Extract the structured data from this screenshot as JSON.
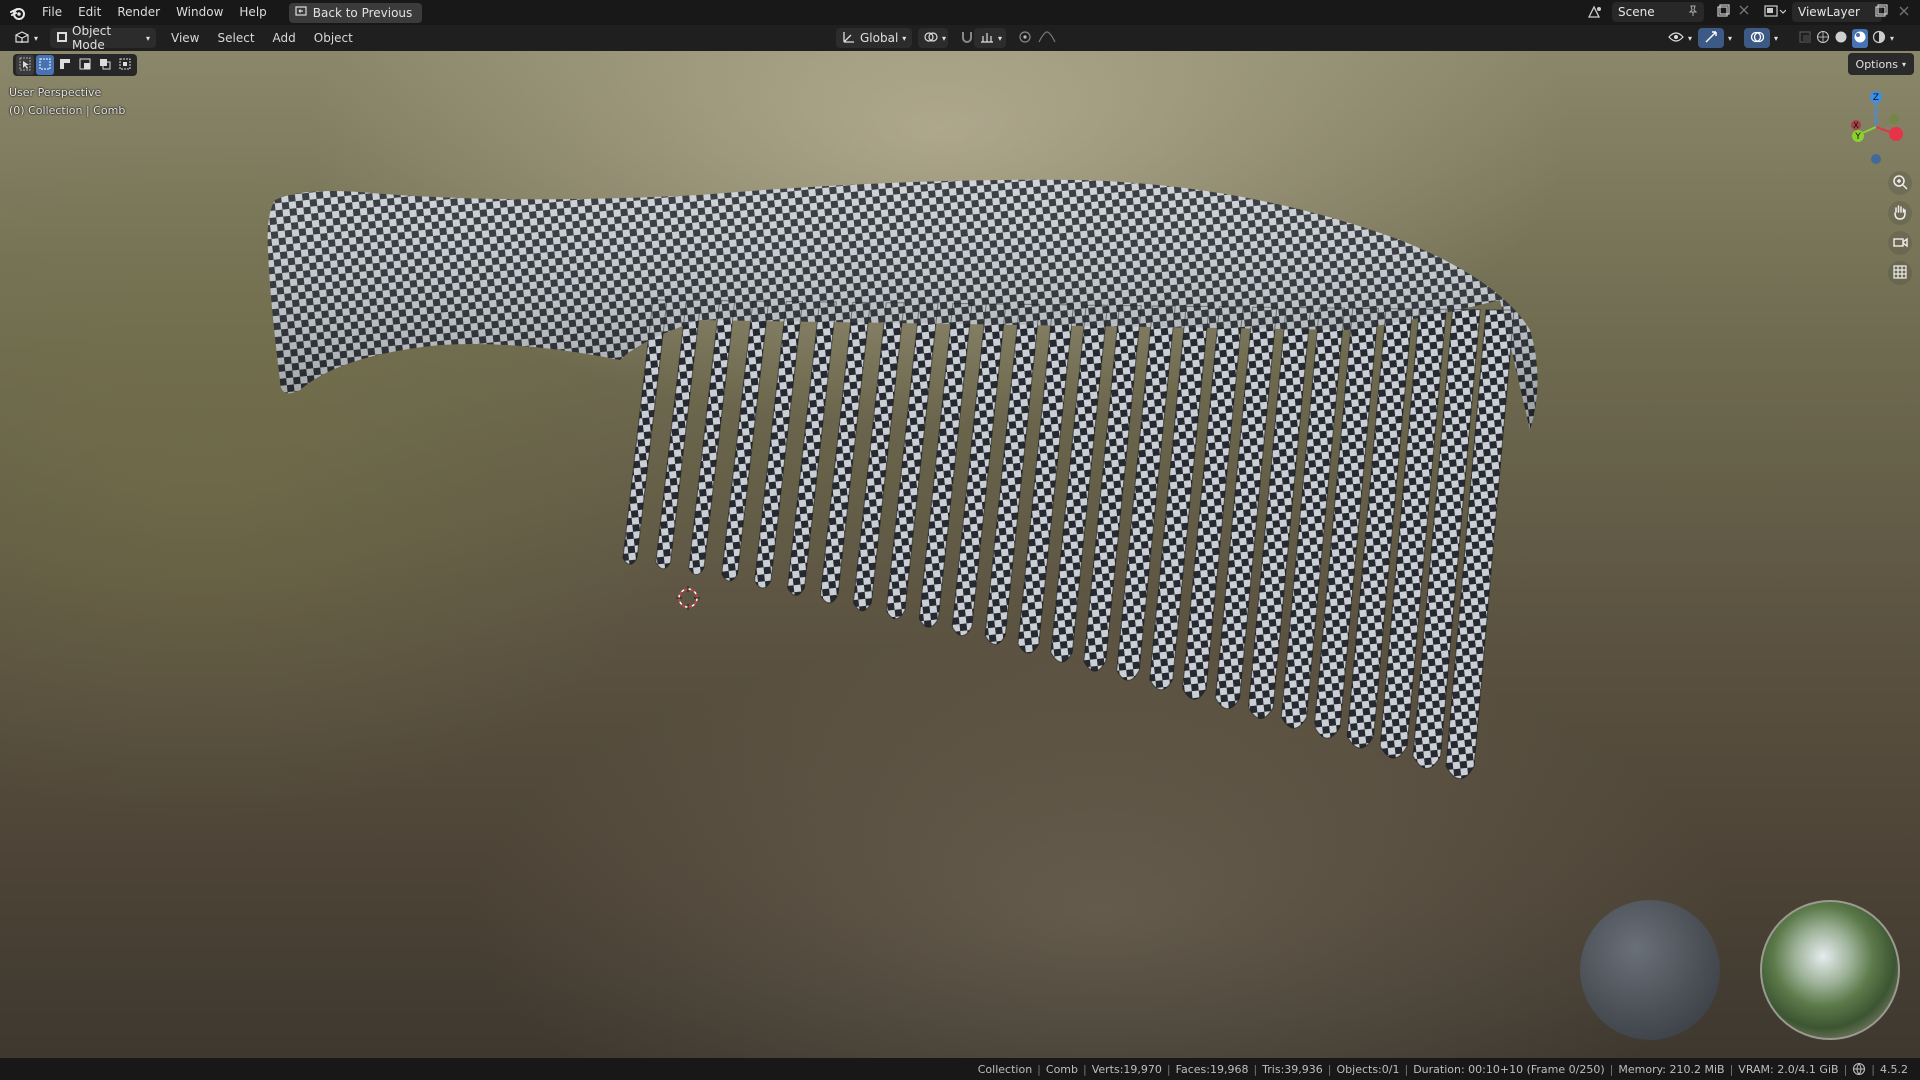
{
  "topbar": {
    "menus": [
      "File",
      "Edit",
      "Render",
      "Window",
      "Help"
    ],
    "back_label": "Back to Previous",
    "scene_label": "Scene",
    "viewlayer_label": "ViewLayer"
  },
  "header": {
    "mode_label": "Object Mode",
    "menus": [
      "View",
      "Select",
      "Add",
      "Object"
    ],
    "orientation_label": "Global"
  },
  "viewport": {
    "perspective_label": "User Perspective",
    "collection_label": "(0) Collection | Comb",
    "options_label": "Options",
    "gizmo": {
      "z": "Z",
      "x": "X",
      "y": "Y"
    }
  },
  "statusbar": {
    "collection": "Collection",
    "object": "Comb",
    "verts": "Verts:19,970",
    "faces": "Faces:19,968",
    "tris": "Tris:39,936",
    "objects": "Objects:0/1",
    "duration": "Duration: 00:10+10 (Frame 0/250)",
    "memory": "Memory: 210.2 MiB",
    "vram": "VRAM: 2.0/4.1 GiB",
    "version": "4.5.2"
  },
  "colors": {
    "accent": "#4772b3",
    "axis_x": "#e5344a",
    "axis_y": "#8bd130",
    "axis_z": "#3d8ee6"
  }
}
